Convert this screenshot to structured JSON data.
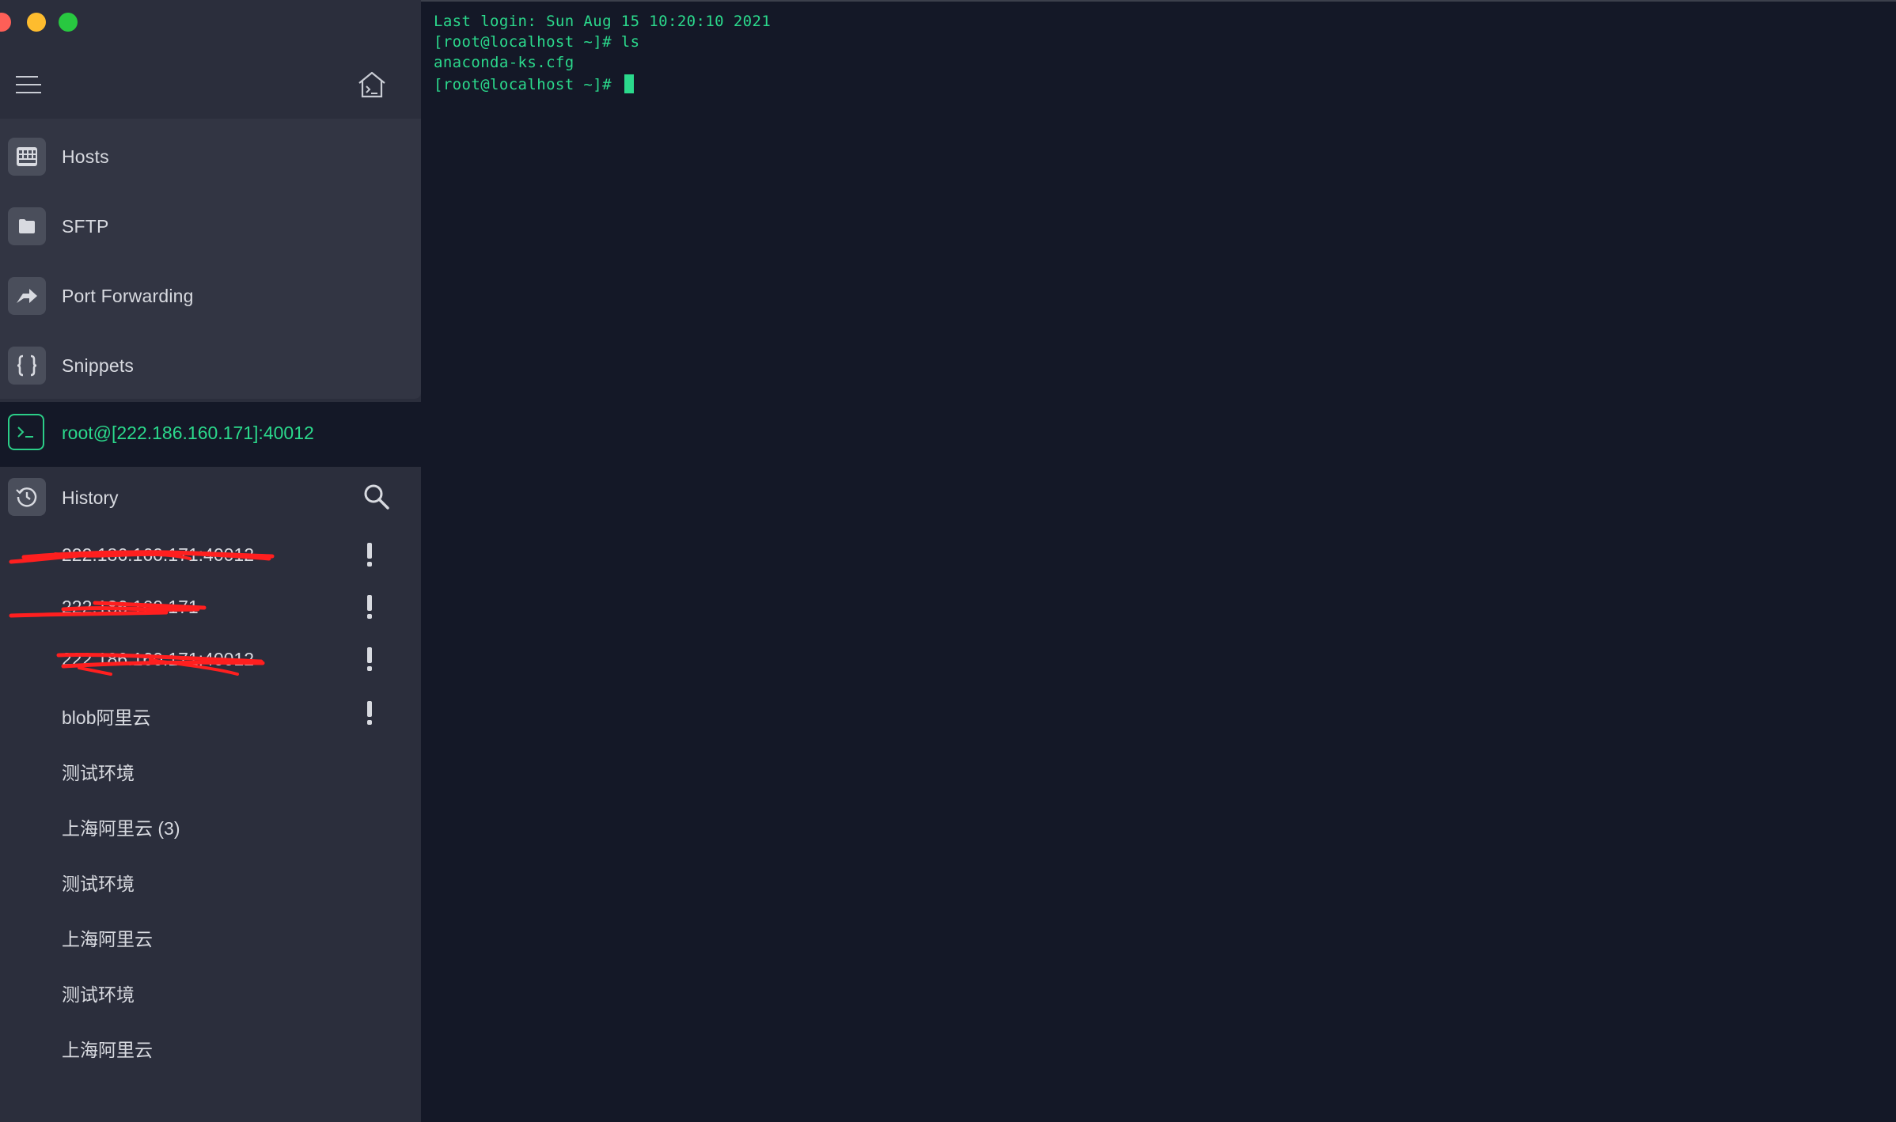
{
  "sidebar": {
    "nav": [
      {
        "label": "Hosts",
        "icon": "hosts-grid-icon"
      },
      {
        "label": "SFTP",
        "icon": "folder-icon"
      },
      {
        "label": "Port Forwarding",
        "icon": "port-forward-arrow-icon"
      },
      {
        "label": "Snippets",
        "icon": "braces-icon"
      }
    ],
    "session": {
      "label": "root@[222.186.160.171]:40012",
      "icon": "terminal-prompt-icon"
    },
    "history": {
      "label": "History",
      "items": [
        {
          "label": "222.186.160.171:40012",
          "redacted": true,
          "warning": true
        },
        {
          "label": "222.186.160.171",
          "redacted": true,
          "warning": true
        },
        {
          "label": "222.186.160.171:40012",
          "redacted": true,
          "warning": true
        },
        {
          "label": "blob阿里云",
          "redacted": false,
          "warning": true
        },
        {
          "label": "测试环境",
          "redacted": false,
          "warning": false
        },
        {
          "label": "上海阿里云 (3)",
          "redacted": false,
          "warning": false
        },
        {
          "label": "测试环境",
          "redacted": false,
          "warning": false
        },
        {
          "label": "上海阿里云",
          "redacted": false,
          "warning": false
        },
        {
          "label": "测试环境",
          "redacted": false,
          "warning": false
        },
        {
          "label": "上海阿里云",
          "redacted": false,
          "warning": false
        }
      ]
    }
  },
  "terminal": {
    "lines": [
      "Last login: Sun Aug 15 10:20:10 2021",
      "[root@localhost ~]# ls",
      "anaconda-ks.cfg",
      "[root@localhost ~]# "
    ]
  },
  "colors": {
    "accent": "#2bd98c",
    "sidebar_bg": "#2b2e3c",
    "nav_bg": "#323543",
    "terminal_bg": "#141827",
    "redaction": "#ff1f1f"
  }
}
